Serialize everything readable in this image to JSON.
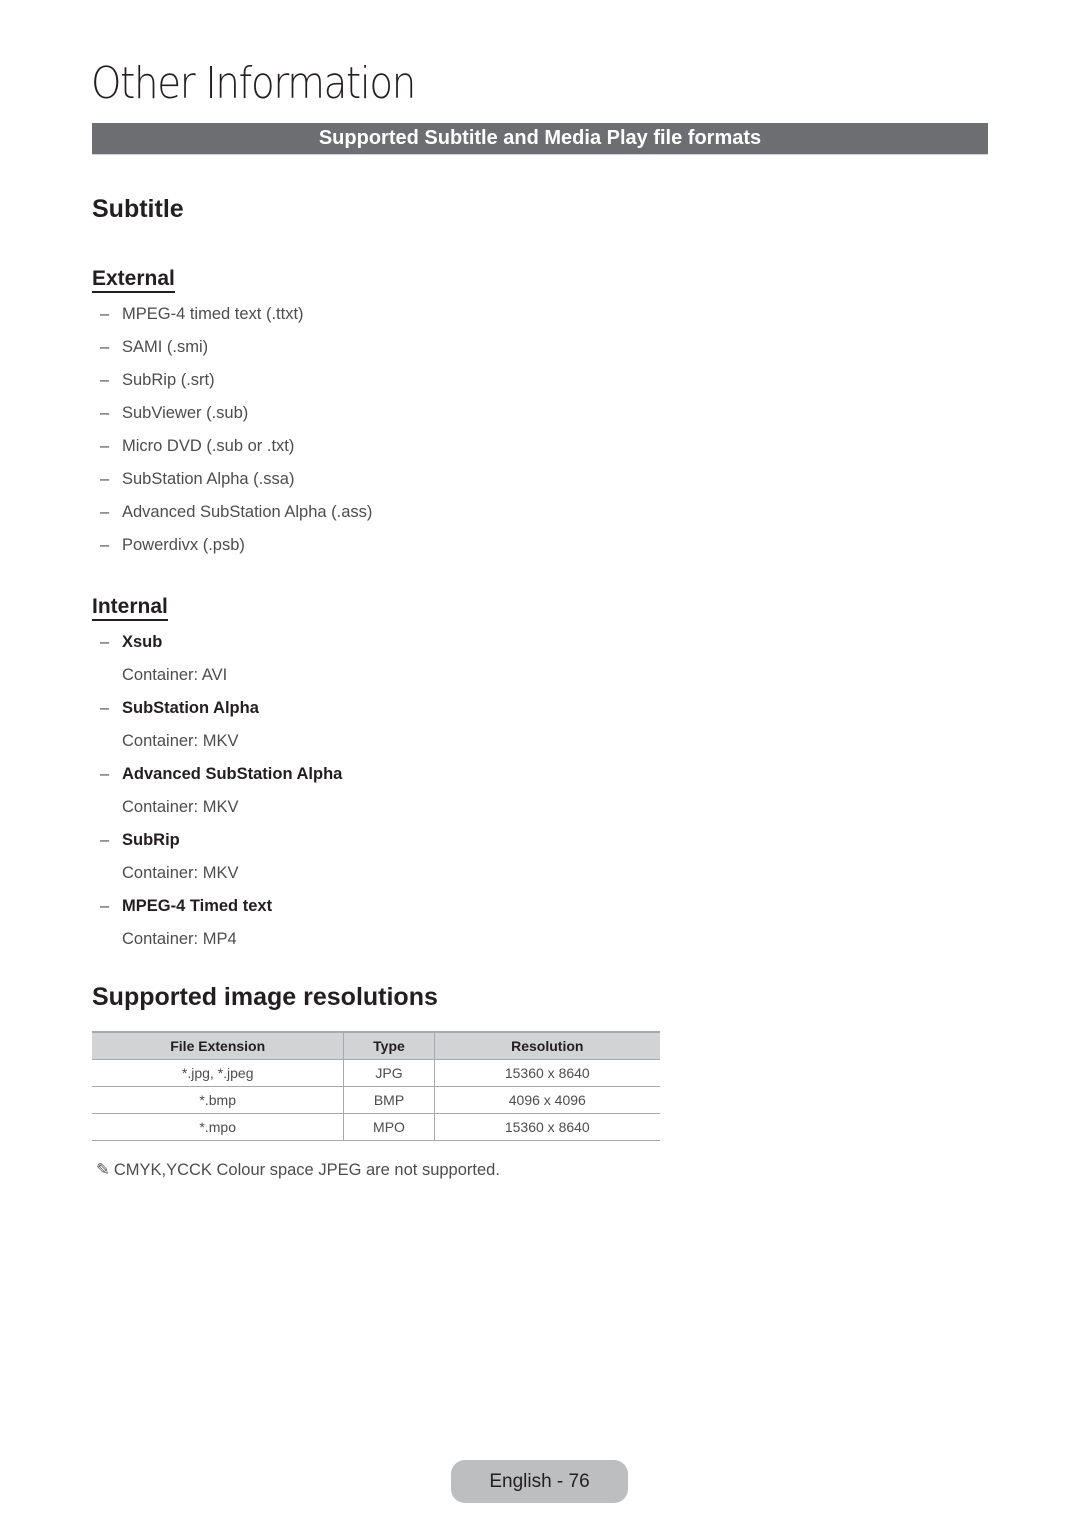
{
  "page": {
    "title": "Other Information",
    "section_header": "Supported Subtitle and Media Play file formats"
  },
  "subtitle": {
    "heading": "Subtitle",
    "external": {
      "heading": "External",
      "items": [
        "MPEG-4 timed text (.ttxt)",
        "SAMI (.smi)",
        "SubRip (.srt)",
        "SubViewer (.sub)",
        "Micro DVD (.sub or .txt)",
        "SubStation Alpha (.ssa)",
        "Advanced SubStation Alpha (.ass)",
        "Powerdivx (.psb)"
      ]
    },
    "internal": {
      "heading": "Internal",
      "items": [
        {
          "name": "Xsub",
          "container": "Container: AVI"
        },
        {
          "name": "SubStation Alpha",
          "container": "Container: MKV"
        },
        {
          "name": "Advanced SubStation Alpha",
          "container": "Container: MKV"
        },
        {
          "name": "SubRip",
          "container": "Container: MKV"
        },
        {
          "name": "MPEG-4 Timed text",
          "container": "Container: MP4"
        }
      ]
    }
  },
  "images": {
    "heading": "Supported image resolutions",
    "table": {
      "headers": [
        "File Extension",
        "Type",
        "Resolution"
      ],
      "rows": [
        [
          "*.jpg, *.jpeg",
          "JPG",
          "15360 x 8640"
        ],
        [
          "*.bmp",
          "BMP",
          "4096 x 4096"
        ],
        [
          "*.mpo",
          "MPO",
          "15360 x 8640"
        ]
      ]
    },
    "note_icon": "pencil-icon",
    "note": "CMYK,YCCK Colour space JPEG are not supported."
  },
  "footer": {
    "page_label": "English - 76"
  },
  "bullet": "–"
}
